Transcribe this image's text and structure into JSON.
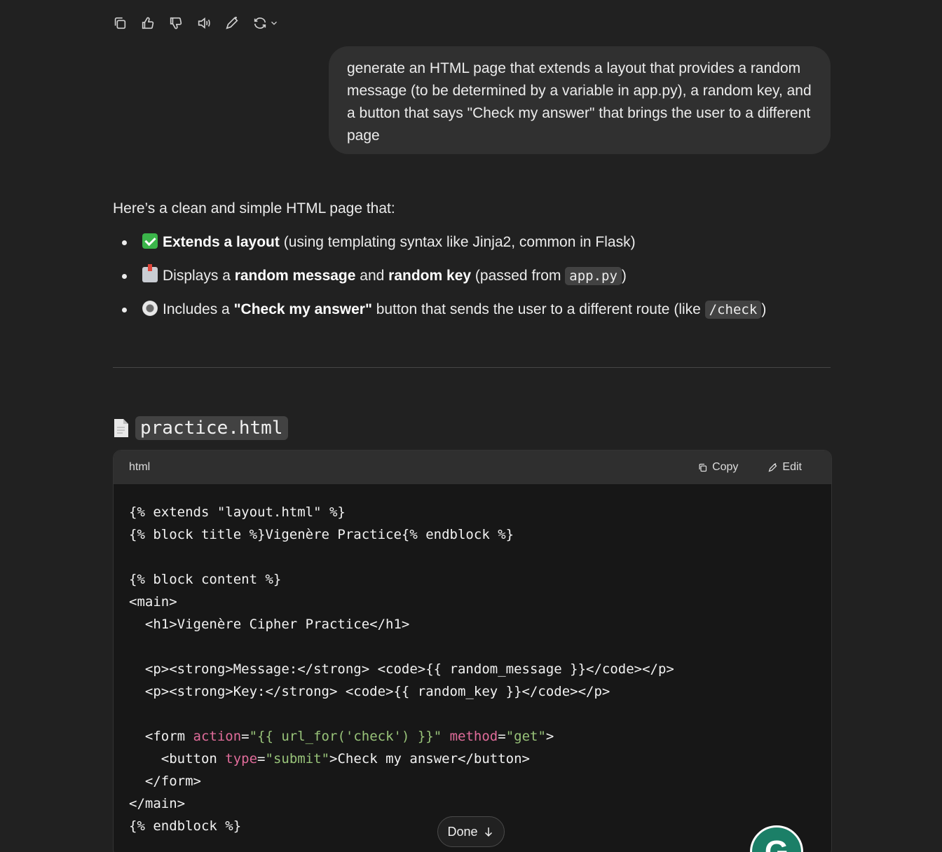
{
  "message_actions": {
    "items": [
      "copy-icon",
      "thumbs-up-icon",
      "thumbs-down-icon",
      "read-aloud-icon",
      "edit-icon",
      "regenerate-icon"
    ]
  },
  "user_message": {
    "text": "generate an HTML page that extends a layout that provides a random message (to be determined by a variable in app.py), a random key, and a button that says \"Check my answer\" that brings the user to a different page"
  },
  "assistant": {
    "intro": "Here’s a clean and simple HTML page that:",
    "bullets": [
      {
        "emoji": "check-mark-emoji",
        "bold1": "Extends a layout",
        "rest": " (using templating syntax like Jinja2, common in Flask)"
      },
      {
        "emoji": "inbox-tray-emoji",
        "text1": "Displays a ",
        "bold1": "random message",
        "text2": " and ",
        "bold2": "random key",
        "text3": " (passed from ",
        "code": "app.py",
        "text4": ")"
      },
      {
        "emoji": "radio-button-emoji",
        "text1": "Includes a ",
        "bold1": "\"Check my answer\"",
        "text2": " button that sends the user to a different route (like ",
        "code": "/check",
        "text3": ")"
      }
    ],
    "file_heading": "practice.html"
  },
  "code_block": {
    "language": "html",
    "copy_label": "Copy",
    "edit_label": "Edit",
    "lines": [
      "{% extends \"layout.html\" %}",
      "{% block title %}Vigenère Practice{% endblock %}",
      "",
      "{% block content %}",
      "<main>",
      "  <h1>Vigenère Cipher Practice</h1>",
      "",
      "  <p><strong>Message:</strong> <code>{{ random_message }}</code></p>",
      "  <p><strong>Key:</strong> <code>{{ random_key }}</code></p>",
      "",
      "  <form action=\"{{ url_for('check') }}\" method=\"get\">",
      "    <button type=\"submit\">Check my answer</button>",
      "  </form>",
      "</main>",
      "{% endblock %}"
    ],
    "form_line": {
      "p1": "  <form ",
      "attr1": "action",
      "eq1": "=",
      "val1": "\"{{ url_for('check') }}\"",
      "sp": " ",
      "attr2": "method",
      "eq2": "=",
      "val2": "\"get\"",
      "end": ">"
    },
    "button_line": {
      "p1": "    <button ",
      "attr1": "type",
      "eq1": "=",
      "val1": "\"submit\"",
      "end": ">Check my answer</button>"
    }
  },
  "done_button": {
    "label": "Done"
  },
  "grammarly": {
    "letter": "G"
  }
}
